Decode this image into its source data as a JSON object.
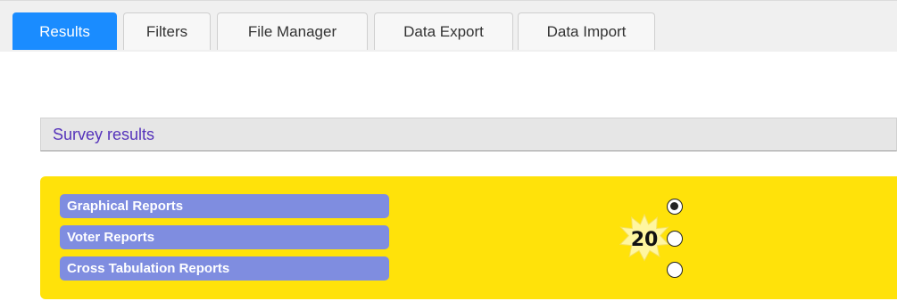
{
  "tabs": [
    {
      "label": "Results",
      "active": true
    },
    {
      "label": "Filters",
      "active": false
    },
    {
      "label": "File Manager",
      "active": false
    },
    {
      "label": "Data Export",
      "active": false
    },
    {
      "label": "Data Import",
      "active": false
    }
  ],
  "section": {
    "title": "Survey results"
  },
  "reports": [
    {
      "label": "Graphical Reports",
      "selected": true
    },
    {
      "label": "Voter Reports",
      "selected": false
    },
    {
      "label": "Cross Tabulation Reports",
      "selected": false
    }
  ],
  "step_badge": {
    "number": "20"
  },
  "colors": {
    "accent": "#1a8cff",
    "panel": "#ffe20a",
    "report_button": "#7f8de0",
    "section_title": "#5533bb"
  }
}
